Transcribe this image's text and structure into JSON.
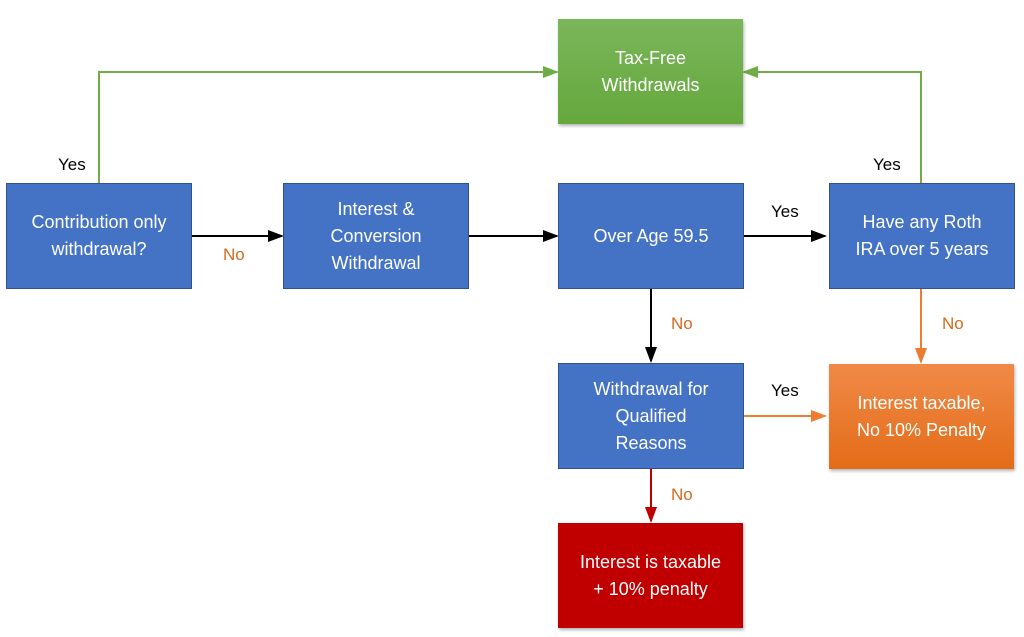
{
  "diagram": {
    "nodes": {
      "contribution": "Contribution only\nwithdrawal?",
      "interest_conversion": "Interest &\nConversion\nWithdrawal",
      "over_age": "Over Age 59.5",
      "roth_5_years": "Have any Roth\nIRA over 5 years",
      "tax_free": "Tax-Free\nWithdrawals",
      "qualified_reasons": "Withdrawal for\nQualified\nReasons",
      "interest_taxable_no_penalty": "Interest taxable,\nNo 10% Penalty",
      "interest_taxable_penalty": "Interest is taxable\n+ 10% penalty"
    },
    "edges": {
      "contribution_yes": "Yes",
      "contribution_no": "No",
      "over_age_yes": "Yes",
      "over_age_no": "No",
      "roth_yes": "Yes",
      "roth_no": "No",
      "qualified_yes": "Yes",
      "qualified_no": "No"
    },
    "colors": {
      "decision": "#4472c4",
      "tax_free": "#70ad47",
      "no_penalty": "#ed7d31",
      "penalty": "#c00000",
      "yes_path": "#70ad47",
      "no_path_orange": "#ed7d31",
      "no_path_red": "#c00000",
      "default_path": "#000000"
    }
  }
}
